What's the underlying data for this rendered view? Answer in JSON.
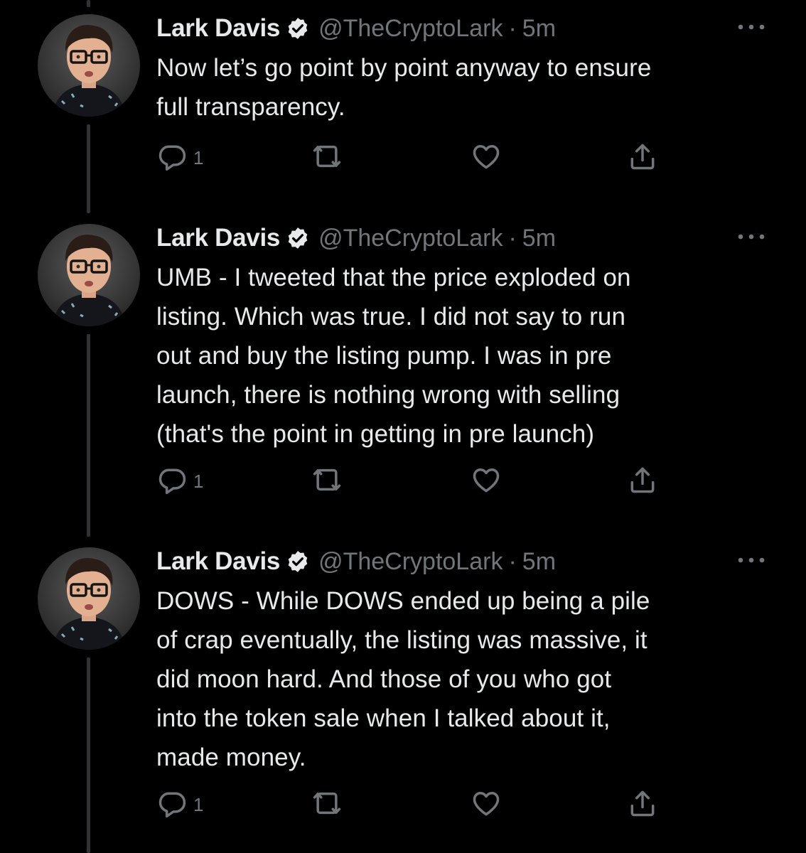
{
  "tweets": [
    {
      "author": {
        "name": "Lark Davis",
        "handle": "@TheCryptoLark",
        "verified": true,
        "avatar_icon": "profile-photo"
      },
      "separator": "·",
      "time": "5m",
      "text": "Now let’s go point by point anyway to ensure\nfull transparency.",
      "actions": {
        "reply_count": "1",
        "retweet_count": "",
        "like_count": ""
      }
    },
    {
      "author": {
        "name": "Lark Davis",
        "handle": "@TheCryptoLark",
        "verified": true,
        "avatar_icon": "profile-photo"
      },
      "separator": "·",
      "time": "5m",
      "text": "UMB - I tweeted that the price exploded on\nlisting. Which was true. I did not say to run\nout and buy the listing pump. I was in pre\nlaunch, there is nothing wrong with selling\n(that's the point in getting in pre launch)",
      "actions": {
        "reply_count": "1",
        "retweet_count": "",
        "like_count": ""
      }
    },
    {
      "author": {
        "name": "Lark Davis",
        "handle": "@TheCryptoLark",
        "verified": true,
        "avatar_icon": "profile-photo"
      },
      "separator": "·",
      "time": "5m",
      "text": "DOWS - While DOWS ended up being a pile\nof crap eventually, the listing was massive, it\ndid moon hard. And those of you who got\ninto the token sale when I talked about it,\nmade money.",
      "actions": {
        "reply_count": "1",
        "retweet_count": "",
        "like_count": ""
      }
    }
  ],
  "icons": {
    "verified": "verified-badge-icon",
    "more": "more-options-icon",
    "reply": "reply-icon",
    "retweet": "retweet-icon",
    "like": "heart-icon",
    "share": "share-icon"
  },
  "colors": {
    "background": "#000000",
    "text_primary": "#e7e9ea",
    "text_secondary": "#71767b",
    "thread_line": "#2f3336"
  }
}
